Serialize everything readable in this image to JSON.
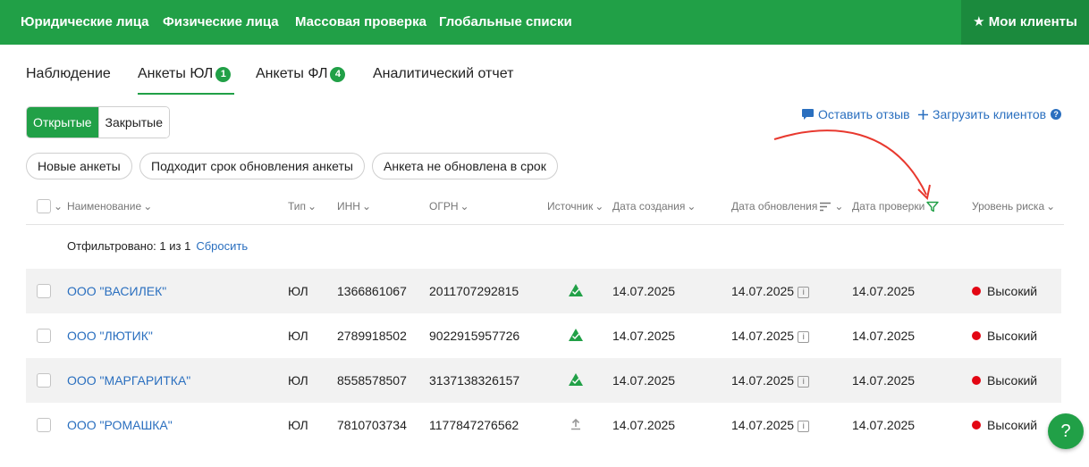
{
  "nav": {
    "items": [
      "Юридические лица",
      "Физические лица",
      "Массовая проверка",
      "Глобальные списки"
    ],
    "my_clients": "Мои клиенты",
    "my_clients_icon": "star-icon"
  },
  "tabs": [
    {
      "label": "Наблюдение",
      "badge": ""
    },
    {
      "label": "Анкеты ЮЛ",
      "badge": "1"
    },
    {
      "label": "Анкеты ФЛ",
      "badge": "4"
    },
    {
      "label": "Аналитический отчет",
      "badge": ""
    }
  ],
  "segments": {
    "open": "Открытые",
    "closed": "Закрытые"
  },
  "links": {
    "feedback": "Оставить отзыв",
    "upload": "Загрузить клиентов"
  },
  "chips": [
    "Новые анкеты",
    "Подходит срок обновления анкеты",
    "Анкета не обновлена в срок"
  ],
  "columns": {
    "name": "Наименование",
    "type": "Тип",
    "inn": "ИНН",
    "ogrn": "ОГРН",
    "source": "Источник",
    "created": "Дата создания",
    "updated": "Дата обновления",
    "checked": "Дата проверки",
    "risk": "Уровень риска"
  },
  "filter": {
    "text": "Отфильтровано: 1 из 1",
    "reset": "Сбросить"
  },
  "rows": [
    {
      "name": "ООО \"ВАСИЛЕК\"",
      "type": "ЮЛ",
      "inn": "1366861067",
      "ogrn": "2011707292815",
      "source_icon": "source-triangle-icon",
      "created": "14.07.2025",
      "updated": "14.07.2025",
      "checked": "14.07.2025",
      "risk": "Высокий"
    },
    {
      "name": "ООО \"ЛЮТИК\"",
      "type": "ЮЛ",
      "inn": "2789918502",
      "ogrn": "9022915957726",
      "source_icon": "source-triangle-icon",
      "created": "14.07.2025",
      "updated": "14.07.2025",
      "checked": "14.07.2025",
      "risk": "Высокий"
    },
    {
      "name": "ООО \"МАРГАРИТКА\"",
      "type": "ЮЛ",
      "inn": "8558578507",
      "ogrn": "3137138326157",
      "source_icon": "source-triangle-icon",
      "created": "14.07.2025",
      "updated": "14.07.2025",
      "checked": "14.07.2025",
      "risk": "Высокий"
    },
    {
      "name": "ООО \"РОМАШКА\"",
      "type": "ЮЛ",
      "inn": "7810703734",
      "ogrn": "1177847276562",
      "source_icon": "upload-icon",
      "created": "14.07.2025",
      "updated": "14.07.2025",
      "checked": "14.07.2025",
      "risk": "Высокий"
    }
  ],
  "help_fab": "?",
  "colors": {
    "brand": "#21a047",
    "brand_dark": "#1b8a3d",
    "link": "#2a6fbf",
    "risk_high": "#e30613",
    "annotation_arrow": "#e8392f"
  }
}
